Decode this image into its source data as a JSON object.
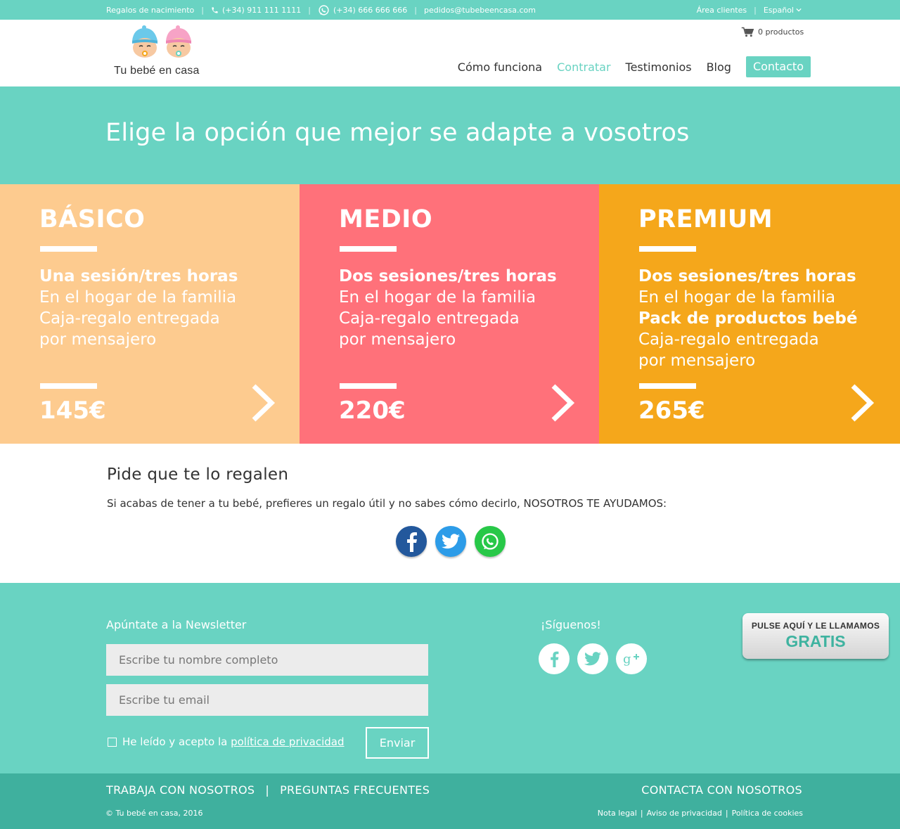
{
  "topbar": {
    "gift_label": "Regalos de nacimiento",
    "phone": "(+34) 911 111 1111",
    "whatsapp": "(+34) 666 666 666",
    "email": "pedidos@tubebeencasa.com",
    "client_area": "Área clientes",
    "language": "Español"
  },
  "header": {
    "logo_text": "Tu bebé en casa",
    "cart": "0 productos",
    "nav": [
      "Cómo funciona",
      "Contratar",
      "Testimonios",
      "Blog",
      "Contacto"
    ]
  },
  "hero": {
    "title": "Elige la opción que mejor se adapte a vosotros"
  },
  "plans": [
    {
      "name": "BÁSICO",
      "color": "#fdcb8f",
      "lines": [
        {
          "text": "Una sesión/tres horas",
          "bold": true
        },
        {
          "text": "En el hogar de la familia",
          "bold": false
        },
        {
          "text": "Caja-regalo entregada",
          "bold": false
        },
        {
          "text": "por mensajero",
          "bold": false
        }
      ],
      "price": "145€"
    },
    {
      "name": "MEDIO",
      "color": "#ff717a",
      "lines": [
        {
          "text": "Dos sesiones/tres horas",
          "bold": true
        },
        {
          "text": "En el hogar de la familia",
          "bold": false
        },
        {
          "text": "Caja-regalo entregada",
          "bold": false
        },
        {
          "text": "por mensajero",
          "bold": false
        }
      ],
      "price": "220€"
    },
    {
      "name": "PREMIUM",
      "color": "#f5a71b",
      "lines": [
        {
          "text": "Dos sesiones/tres horas",
          "bold": true
        },
        {
          "text": "En el hogar de la familia",
          "bold": false
        },
        {
          "text": "Pack de productos bebé",
          "bold": true
        },
        {
          "text": "Caja-regalo entregada",
          "bold": false
        },
        {
          "text": "por mensajero",
          "bold": false
        }
      ],
      "price": "265€"
    }
  ],
  "gift": {
    "title": "Pide que te lo regalen",
    "text": "Si acabas de tener a tu bebé, prefieres un regalo útil y no sabes cómo decirlo, NOSOTROS TE AYUDAMOS:"
  },
  "footer": {
    "newsletter_title": "Apúntate a la Newsletter",
    "name_placeholder": "Escribe tu nombre completo",
    "email_placeholder": "Escribe tu email",
    "privacy_text": "He leído y acepto la",
    "privacy_link": "política de privacidad",
    "send": "Enviar",
    "follow": "¡Síguenos!",
    "call_line1": "PULSE AQUÍ Y LE LLAMAMOS",
    "call_line2": "GRATIS"
  },
  "bottom": {
    "work": "TRABAJA CON NOSOTROS",
    "faq": "PREGUNTAS FRECUENTES",
    "separator": "|",
    "contact": "CONTACTA CON NOSOTROS",
    "copyright": "© Tu bebé en casa, 2016",
    "legal": [
      "Nota legal",
      "Aviso de privacidad",
      "Política de cookies"
    ]
  },
  "colors": {
    "mint": "#69d3c2",
    "dark_mint": "#3fb09e",
    "facebook": "#23589c",
    "twitter": "#2d9ce8",
    "whatsapp": "#28c848"
  }
}
